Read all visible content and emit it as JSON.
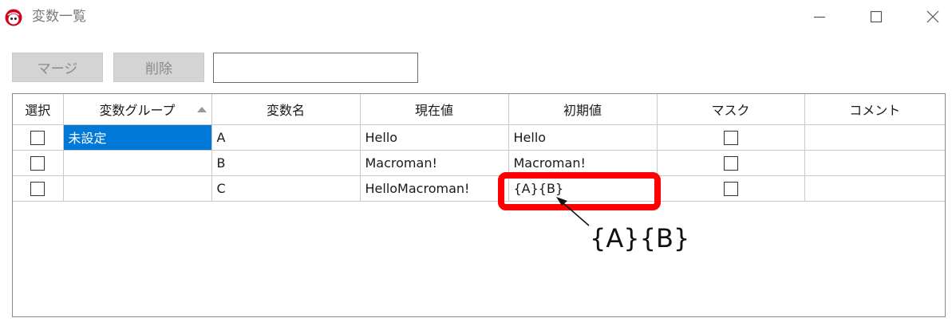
{
  "window": {
    "title": "変数一覧",
    "icon": "app-logo-icon",
    "controls": [
      "minimize-icon",
      "maximize-icon",
      "close-icon"
    ]
  },
  "toolbar": {
    "merge_label": "マージ",
    "delete_label": "削除",
    "search_value": "",
    "search_placeholder": ""
  },
  "table": {
    "columns": [
      "選択",
      "変数グループ",
      "変数名",
      "現在値",
      "初期値",
      "マスク",
      "コメント"
    ],
    "sorted_column": "変数グループ",
    "sort_direction": "ascending",
    "rows": [
      {
        "selected": false,
        "group": "未設定",
        "name": "A",
        "current": "Hello",
        "initial": "Hello",
        "mask": false,
        "comment": ""
      },
      {
        "selected": false,
        "group": "",
        "name": "B",
        "current": "Macroman!",
        "initial": "Macroman!",
        "mask": false,
        "comment": ""
      },
      {
        "selected": false,
        "group": "",
        "name": "C",
        "current": "HelloMacroman!",
        "initial": "{A}{B}",
        "mask": false,
        "comment": ""
      }
    ],
    "selected_cell_color": "#0078d7"
  },
  "annotation": {
    "callout_text": "{A}{B}",
    "highlight_color": "#ff0000"
  }
}
